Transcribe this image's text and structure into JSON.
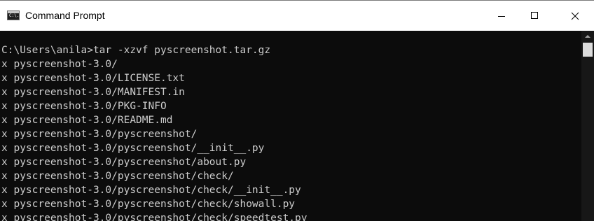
{
  "window": {
    "title": "Command Prompt",
    "icon": "command-prompt-icon",
    "icon_text": "C:\\."
  },
  "terminal": {
    "lines": [
      "C:\\Users\\anila>tar -xzvf pyscreenshot.tar.gz",
      "x pyscreenshot-3.0/",
      "x pyscreenshot-3.0/LICENSE.txt",
      "x pyscreenshot-3.0/MANIFEST.in",
      "x pyscreenshot-3.0/PKG-INFO",
      "x pyscreenshot-3.0/README.md",
      "x pyscreenshot-3.0/pyscreenshot/",
      "x pyscreenshot-3.0/pyscreenshot/__init__.py",
      "x pyscreenshot-3.0/pyscreenshot/about.py",
      "x pyscreenshot-3.0/pyscreenshot/check/",
      "x pyscreenshot-3.0/pyscreenshot/check/__init__.py",
      "x pyscreenshot-3.0/pyscreenshot/check/showall.py",
      "x pyscreenshot-3.0/pyscreenshot/check/speedtest.py"
    ]
  },
  "colors": {
    "terminal_bg": "#0c0c0c",
    "terminal_fg": "#cccccc",
    "titlebar_bg": "#ffffff"
  }
}
